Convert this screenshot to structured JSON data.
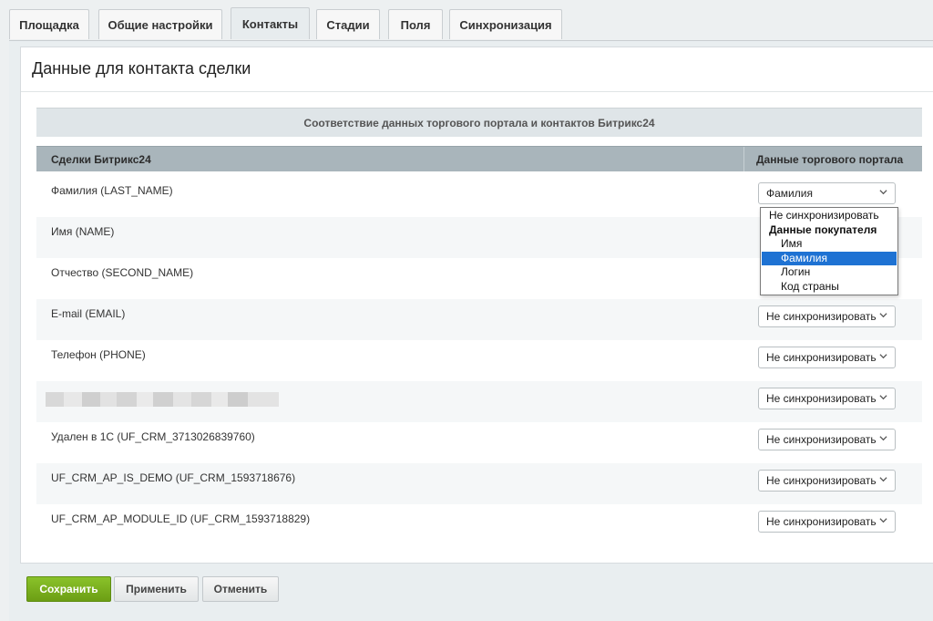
{
  "tabs": [
    {
      "label": "Площадка"
    },
    {
      "label": "Общие настройки"
    },
    {
      "label": "Контакты"
    },
    {
      "label": "Стадии"
    },
    {
      "label": "Поля"
    },
    {
      "label": "Синхронизация"
    }
  ],
  "active_tab": "Контакты",
  "page": {
    "title": "Данные для контакта сделки",
    "section_header": "Соответствие данных торгового портала и контактов Битрикс24",
    "col_left": "Сделки Битрикс24",
    "col_right": "Данные торгового портала"
  },
  "rows": [
    {
      "label": "Фамилия (LAST_NAME)",
      "value": "Фамилия"
    },
    {
      "label": "Имя (NAME)",
      "value": ""
    },
    {
      "label": "Отчество (SECOND_NAME)",
      "value": ""
    },
    {
      "label": "E-mail (EMAIL)",
      "value": "Не синхронизировать"
    },
    {
      "label": "Телефон (PHONE)",
      "value": "Не синхронизировать"
    },
    {
      "label": "",
      "value": "Не синхронизировать"
    },
    {
      "label": "Удален в 1С (UF_CRM_3713026839760)",
      "value": "Не синхронизировать"
    },
    {
      "label": "UF_CRM_AP_IS_DEMO (UF_CRM_1593718676)",
      "value": "Не синхронизировать"
    },
    {
      "label": "UF_CRM_AP_MODULE_ID (UF_CRM_1593718829)",
      "value": "Не синхронизировать"
    }
  ],
  "dropdown": {
    "items": [
      {
        "label": "Не синхронизировать",
        "kind": "opt"
      },
      {
        "label": "Данные покупателя",
        "kind": "grp"
      },
      {
        "label": "Имя",
        "kind": "sub"
      },
      {
        "label": "Фамилия",
        "kind": "sub",
        "selected": true
      },
      {
        "label": "Логин",
        "kind": "sub"
      },
      {
        "label": "Код страны",
        "kind": "sub"
      }
    ]
  },
  "buttons": {
    "save": "Сохранить",
    "apply": "Применить",
    "cancel": "Отменить"
  },
  "colors": {
    "accent_green": "#6c9e14",
    "selected_blue": "#1e72d3",
    "column_header": "#a9b5bb"
  }
}
